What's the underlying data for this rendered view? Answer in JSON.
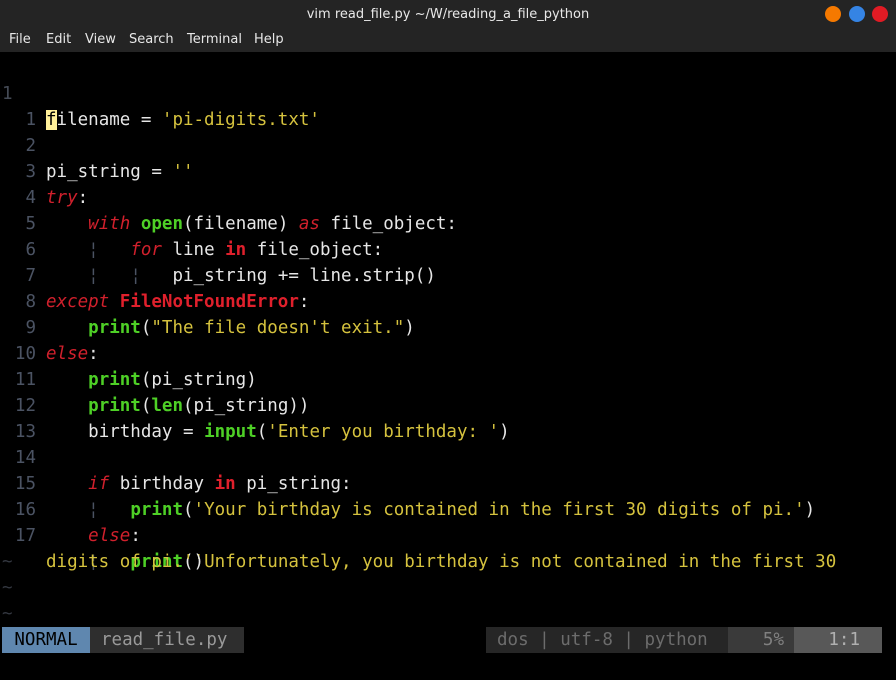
{
  "window": {
    "title": "vim read_file.py  ~/W/reading_a_file_python",
    "buttons": [
      {
        "name": "minimize",
        "color": "#f57900"
      },
      {
        "name": "maximize",
        "color": "#3584e4"
      },
      {
        "name": "close",
        "color": "#e01b24"
      }
    ]
  },
  "menu": {
    "items": [
      "File",
      "Edit",
      "View",
      "Search",
      "Terminal",
      "Help"
    ]
  },
  "editor": {
    "lines": [
      {
        "num": "1"
      },
      {
        "num": "1"
      },
      {
        "num": "2"
      },
      {
        "num": "3"
      },
      {
        "num": "4"
      },
      {
        "num": "5"
      },
      {
        "num": "6"
      },
      {
        "num": "7"
      },
      {
        "num": "8"
      },
      {
        "num": "9"
      },
      {
        "num": "10"
      },
      {
        "num": "11"
      },
      {
        "num": "12"
      },
      {
        "num": "13"
      },
      {
        "num": "14"
      },
      {
        "num": "15"
      },
      {
        "num": "16"
      },
      {
        "num": "17"
      }
    ],
    "code": {
      "l0_cursor": "f",
      "l0_rest": "ilename = ",
      "l0_str": "'pi-digits.txt'",
      "l2_a": "pi_string = ",
      "l2_str": "''",
      "l3_kw": "try",
      "l3_rest": ":",
      "l4_kw": "with",
      "l4_fn": "open",
      "l4_mid": "(filename) ",
      "l4_kw2": "as",
      "l4_rest": " file_object:",
      "l5_guide": "¦",
      "l5_kw": "for",
      "l5_mid": " line ",
      "l5_kw2": "in",
      "l5_rest": " file_object:",
      "l6_guide1": "¦",
      "l6_guide2": "¦",
      "l6_rest": "pi_string += line.strip()",
      "l7_kw": "except",
      "l7_err": "FileNotFoundError",
      "l7_rest": ":",
      "l8_fn": "print",
      "l8_open": "(",
      "l8_str": "\"The file doesn't exit.\"",
      "l8_close": ")",
      "l9_kw": "else",
      "l9_rest": ":",
      "l10_fn": "print",
      "l10_rest": "(pi_string)",
      "l11_fn": "print",
      "l11_open": "(",
      "l11_fn2": "len",
      "l11_rest": "(pi_string))",
      "l12_a": "birthday = ",
      "l12_fn": "input",
      "l12_open": "(",
      "l12_str": "'Enter you birthday: '",
      "l12_close": ")",
      "l14_kw": "if",
      "l14_mid": " birthday ",
      "l14_kw2": "in",
      "l14_rest": " pi_string:",
      "l15_guide": "¦",
      "l15_fn": "print",
      "l15_open": "(",
      "l15_str": "'Your birthday is contained in the first 30 digits of pi.'",
      "l15_close": ")",
      "l16_kw": "else",
      "l16_rest": ":",
      "l17_guide": "¦",
      "l17_fn": "print",
      "l17_open": "(",
      "l17_str": "'Unfortunately, you birthday is not contained in the first 30",
      "l17b_str": "digits of pi.'",
      "l17b_close": ")"
    },
    "tilde": "~"
  },
  "statusline": {
    "mode": "NORMAL",
    "filename": "read_file.py",
    "info": "dos | utf-8 | python",
    "percent": "5%",
    "position": "1:1",
    "colors": {
      "mode_bg": "#5f87af",
      "mode_fg": "#000000",
      "file_bg": "#2e2e2e",
      "file_fg": "#9a9a9a",
      "info_bg": "#262626",
      "info_fg": "#6c6c6c",
      "pct_bg": "#3a3a3a",
      "pos_bg": "#585858"
    }
  }
}
